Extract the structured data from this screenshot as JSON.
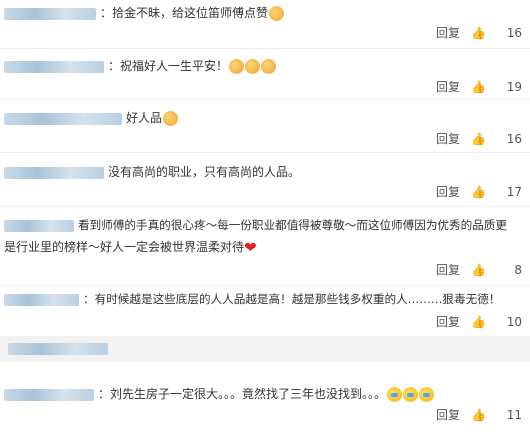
{
  "comments": [
    {
      "text": "：拾金不昧，给这位笛师傅点赞",
      "reply": "回复",
      "likes": "16",
      "emojis": [
        "thumb"
      ]
    },
    {
      "text": "：祝福好人一生平安！",
      "reply": "回复",
      "likes": "19",
      "emojis": [
        "thumb",
        "thumb",
        "thumb"
      ]
    },
    {
      "text": "好人品",
      "reply": "回复",
      "likes": "16",
      "emojis": [
        "thumb"
      ]
    },
    {
      "text": "没有高尚的职业，只有高尚的人品。",
      "reply": "回复",
      "likes": "17"
    },
    {
      "text_line1": "看到师傅的手真的很心疼～每一份职业都值得被尊敬～而这位师傅因为优秀的品质更",
      "text_line2": "是行业里的榜样～好人一定会被世界温柔对待",
      "reply": "回复",
      "likes": "8",
      "emojis": [
        "heart"
      ]
    },
    {
      "text": "：有时候越是这些底层的人人品越是高！越是那些钱多权重的人………狠毒无德！",
      "reply": "回复",
      "likes": "10"
    },
    {
      "text": "：刘先生房子一定很大。。。竟然找了三年也没找到。。。",
      "reply": "回复",
      "likes": "11",
      "emojis": [
        "cry",
        "cry",
        "cry"
      ]
    }
  ],
  "icons": {
    "like": "thumbs-up-icon"
  }
}
